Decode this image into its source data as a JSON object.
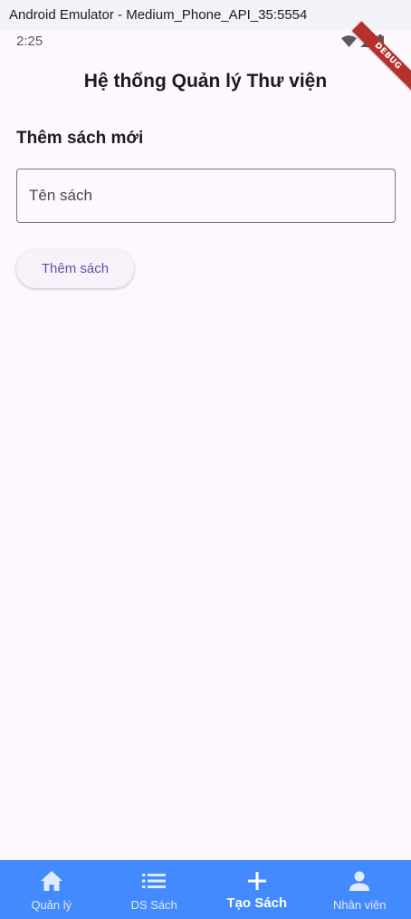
{
  "window": {
    "title": "Android Emulator - Medium_Phone_API_35:5554"
  },
  "status_bar": {
    "time": "2:25",
    "icons": [
      "wifi-icon",
      "signal-icon",
      "battery-icon"
    ]
  },
  "debug_banner": "DEBUG",
  "app_bar": {
    "title": "Hệ thống Quản lý Thư viện"
  },
  "form": {
    "section_title": "Thêm sách mới",
    "book_name": {
      "value": "",
      "placeholder": "Tên sách"
    },
    "submit_label": "Thêm sách"
  },
  "bottom_nav": {
    "background": "#448aff",
    "items": [
      {
        "label": "Quản lý",
        "icon": "home-icon",
        "active": false
      },
      {
        "label": "DS Sách",
        "icon": "list-icon",
        "active": false
      },
      {
        "label": "Tạo Sách",
        "icon": "add-icon",
        "active": true
      },
      {
        "label": "Nhân viên",
        "icon": "person-icon",
        "active": false
      }
    ]
  },
  "colors": {
    "accent": "#6750a4",
    "background": "#fdf7fe",
    "nav_background": "#448aff"
  }
}
